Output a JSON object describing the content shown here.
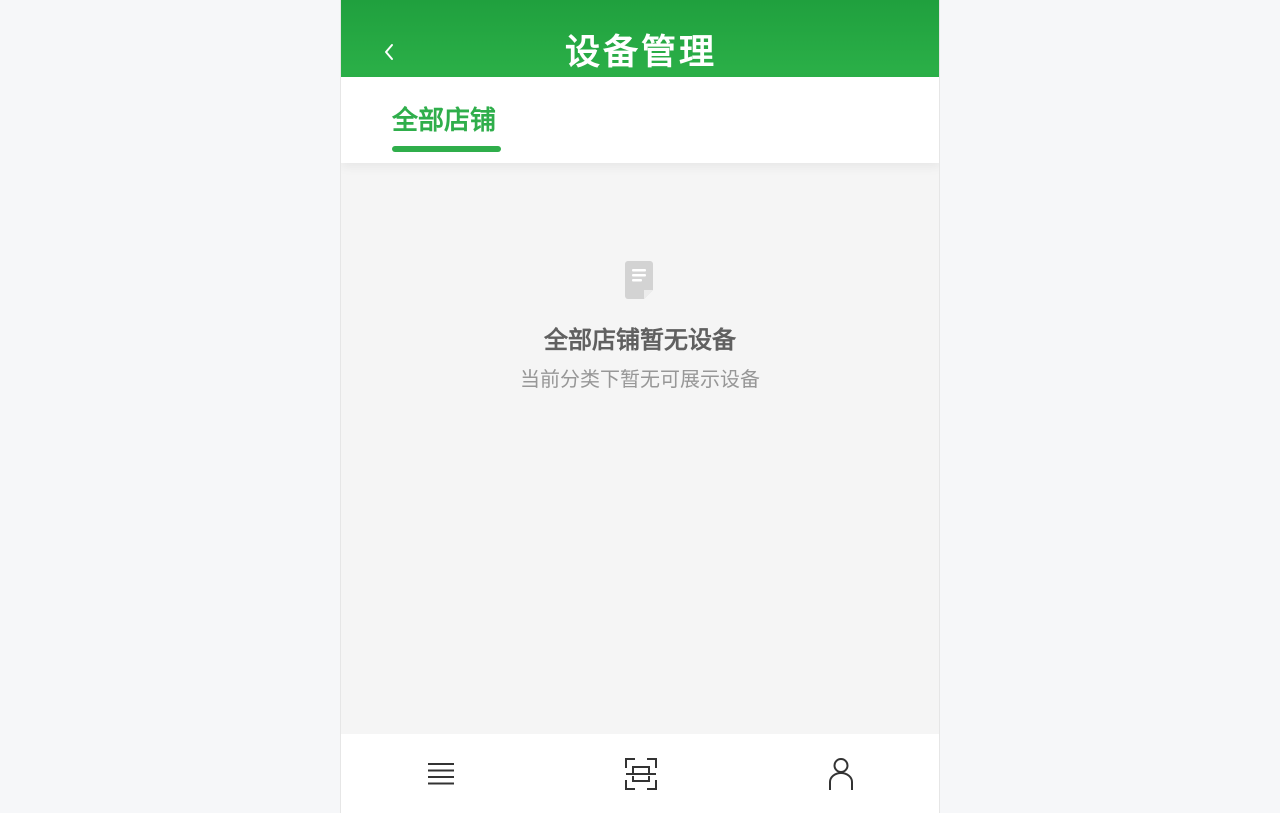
{
  "header": {
    "title": "设备管理",
    "back_icon": "chevron-left-icon"
  },
  "tabs": [
    {
      "label": "全部店铺",
      "active": true
    }
  ],
  "empty_state": {
    "icon": "document-icon",
    "title": "全部店铺暂无设备",
    "subtitle": "当前分类下暂无可展示设备"
  },
  "bottom_nav": [
    {
      "icon": "menu-list-icon"
    },
    {
      "icon": "scan-icon"
    },
    {
      "icon": "user-icon"
    }
  ],
  "colors": {
    "brand_green": "#2fae4b",
    "header_green_top": "#20a03e",
    "header_green_bottom": "#2bb048",
    "page_bg": "#f5f5f5"
  }
}
